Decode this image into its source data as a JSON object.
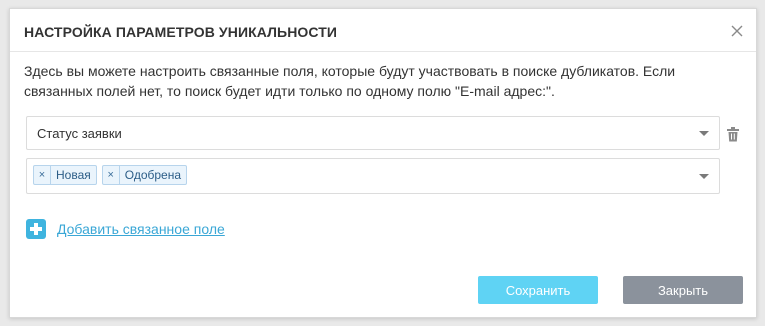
{
  "dialog": {
    "title": "НАСТРОЙКА ПАРАМЕТРОВ УНИКАЛЬНОСТИ",
    "description": "Здесь вы можете настроить связанные поля, которые будут участвовать в поиске дубликатов. Если связанных полей нет, то поиск будет идти только по одному полю \"E-mail адрес:\"."
  },
  "field_select": {
    "value": "Статус заявки"
  },
  "values_select": {
    "tags": [
      {
        "remove": "×",
        "label": "Новая"
      },
      {
        "remove": "×",
        "label": "Одобрена"
      }
    ]
  },
  "add_link": {
    "label": "Добавить связанное поле"
  },
  "buttons": {
    "save": "Сохранить",
    "close": "Закрыть"
  },
  "colors": {
    "accent": "#5fd3f4",
    "link": "#3aa7d6",
    "close_button": "#8b929c",
    "tag_bg": "#eaf4fc"
  },
  "icons": {
    "close": "close-icon",
    "trash": "trash-icon",
    "add": "plus-square-icon"
  }
}
